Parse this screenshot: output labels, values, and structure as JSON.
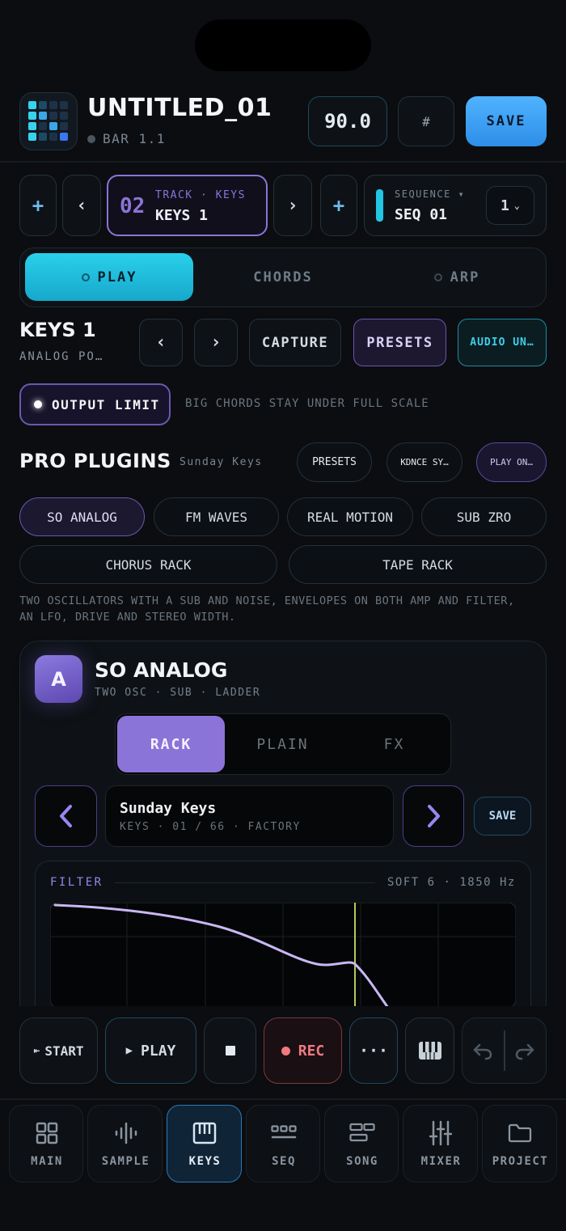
{
  "header": {
    "title": "UNTITLED_01",
    "bar": "BAR 1.1",
    "tempo": "90.0",
    "grid_symbol": "#",
    "save": "SAVE"
  },
  "track": {
    "add": "+",
    "prev": "‹",
    "number": "02",
    "meta": "TRACK · KEYS",
    "name": "KEYS 1",
    "next": "›",
    "add2": "+",
    "seq_label": "SEQUENCE ▾",
    "seq_name": "SEQ 01",
    "seq_select": "1"
  },
  "mode_tabs": {
    "play": "PLAY",
    "chords": "CHORDS",
    "arp": "ARP"
  },
  "instrument": {
    "name": "KEYS 1",
    "sub": "ANALOG PO…",
    "prev": "‹",
    "next": "›",
    "capture": "CAPTURE",
    "presets": "PRESETS",
    "audio_unit": "AUDIO UN…"
  },
  "output_limit": {
    "label": "OUTPUT LIMIT",
    "hint": "BIG CHORDS STAY UNDER FULL SCALE"
  },
  "pro_plugins": {
    "title": "PRO PLUGINS",
    "subtitle": "Sunday Keys",
    "presets": "PRESETS",
    "kdnce": "KDNCE SY…",
    "play_on": "PLAY ON…",
    "plugins": [
      "SO ANALOG",
      "FM WAVES",
      "REAL MOTION",
      "SUB ZRO",
      "CHORUS RACK",
      "TAPE RACK"
    ],
    "description_line1": "TWO OSCILLATORS WITH A SUB AND NOISE, ENVELOPES ON BOTH AMP AND FILTER,",
    "description_line2": "AN LFO, DRIVE AND STEREO WIDTH."
  },
  "synth": {
    "avatar": "A",
    "name": "SO ANALOG",
    "sub": "TWO OSC · SUB · LADDER",
    "view_tabs": {
      "rack": "RACK",
      "plain": "PLAIN",
      "fx": "FX"
    },
    "preset_name": "Sunday Keys",
    "preset_meta": "KEYS · 01 / 66 · FACTORY",
    "save": "SAVE",
    "filter_label": "FILTER",
    "filter_info": "SOFT 6 · 1850 Hz"
  },
  "transport": {
    "start": "START",
    "play": "PLAY",
    "rec": "REC",
    "more": "···"
  },
  "bottom_nav": [
    "MAIN",
    "SAMPLE",
    "KEYS",
    "SEQ",
    "SONG",
    "MIXER",
    "PROJECT"
  ],
  "colors": {
    "accent_cyan": "#22c5e2",
    "accent_purple": "#8b74d8",
    "save_blue": "#3aa0f0",
    "rec_red": "#f07a80",
    "filter_marker": "#b7c95a"
  }
}
